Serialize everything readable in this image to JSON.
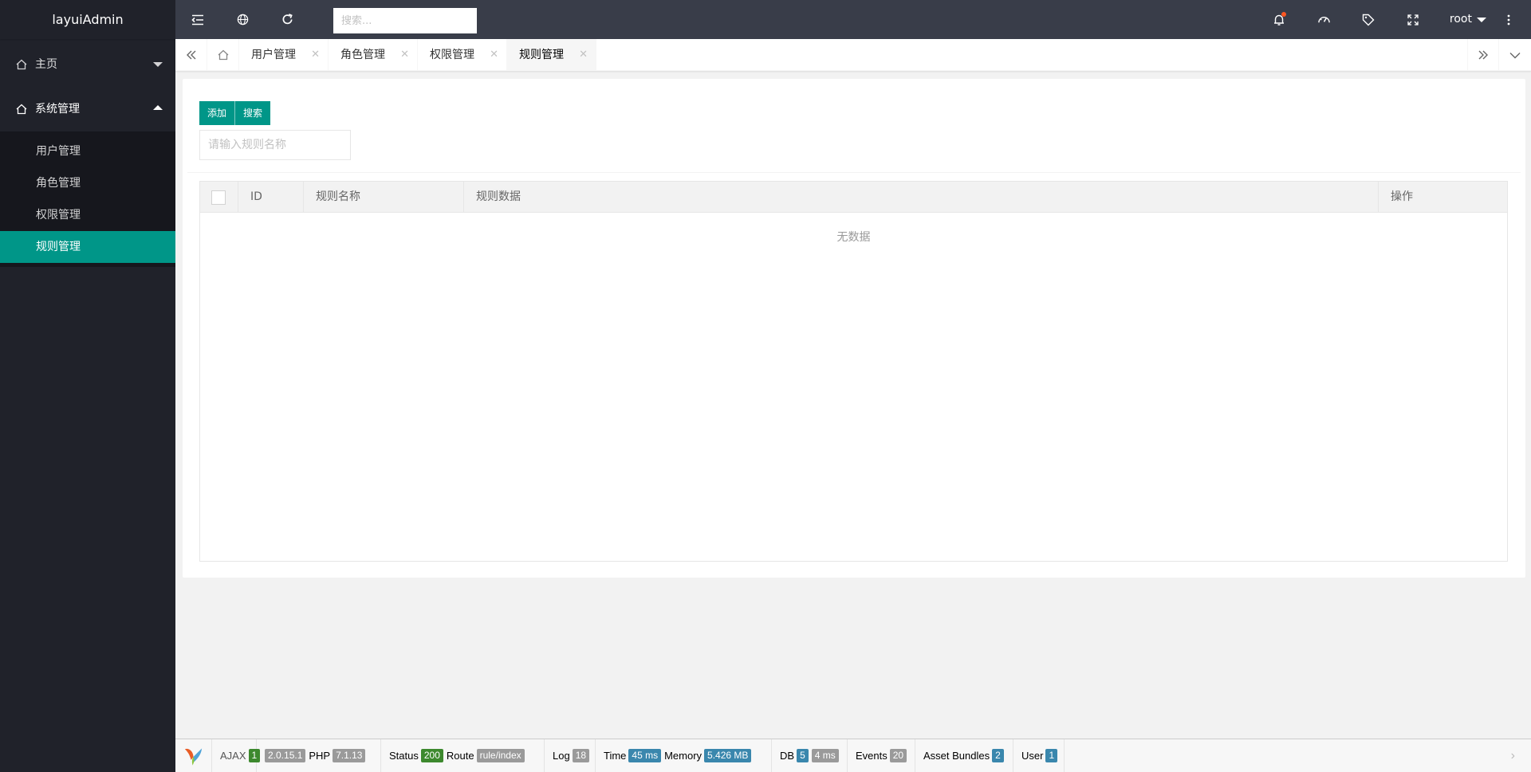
{
  "sidebar": {
    "logo": "layuiAdmin",
    "menu": [
      {
        "label": "主页",
        "icon": "home-icon"
      },
      {
        "label": "系统管理",
        "icon": "home-icon"
      }
    ],
    "submenu": [
      "用户管理",
      "角色管理",
      "权限管理",
      "规则管理"
    ]
  },
  "header": {
    "search_placeholder": "搜索...",
    "user": "root"
  },
  "tabs": [
    "用户管理",
    "角色管理",
    "权限管理",
    "规则管理"
  ],
  "toolbar": {
    "add_label": "添加",
    "search_label": "搜索",
    "rule_placeholder": "请输入规则名称"
  },
  "table": {
    "columns": [
      "ID",
      "规则名称",
      "规则数据",
      "操作"
    ],
    "empty_text": "无数据"
  },
  "debug": {
    "ajax_label": "AJAX",
    "ajax_count": "1",
    "yii_version": "2.0.15.1",
    "php_label": "PHP",
    "php_version": "7.1.13",
    "status_label": "Status",
    "status_code": "200",
    "route_label": "Route",
    "route": "rule/index",
    "log_label": "Log",
    "log_count": "18",
    "time_label": "Time",
    "time": "45 ms",
    "memory_label": "Memory",
    "memory": "5.426 MB",
    "db_label": "DB",
    "db_count": "5",
    "db_time": "4 ms",
    "events_label": "Events",
    "events_count": "20",
    "bundles_label": "Asset Bundles",
    "bundles_count": "2",
    "user_label": "User",
    "user_count": "1"
  }
}
